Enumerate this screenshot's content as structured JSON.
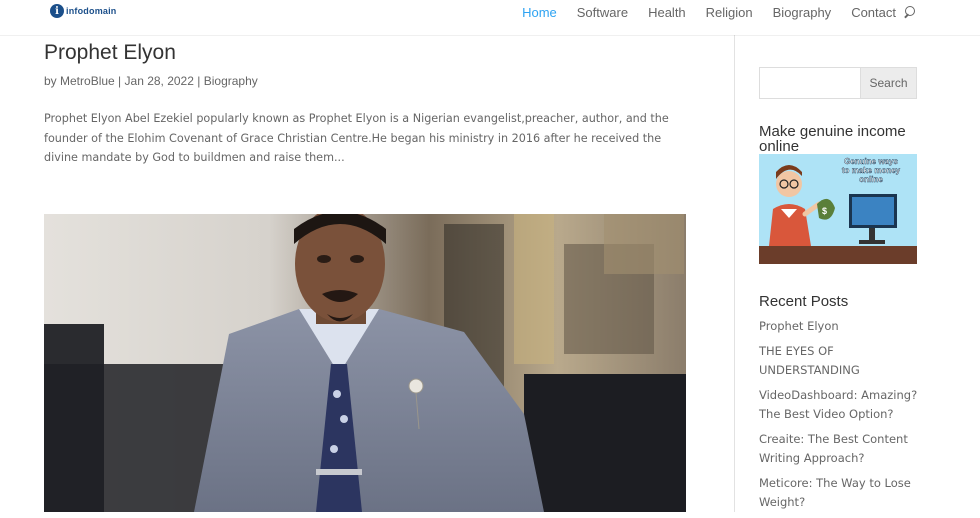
{
  "site": {
    "logo_letter": "i",
    "logo_text": "infodomain"
  },
  "nav": {
    "items": [
      {
        "label": "Home",
        "active": true
      },
      {
        "label": "Software",
        "active": false
      },
      {
        "label": "Health",
        "active": false
      },
      {
        "label": "Religion",
        "active": false
      },
      {
        "label": "Biography",
        "active": false
      },
      {
        "label": "Contact",
        "active": false
      }
    ],
    "search_icon": "search-icon"
  },
  "post": {
    "title": "Prophet Elyon",
    "author": "MetroBlue",
    "date": "Jan 28, 2022",
    "category": "Biography",
    "excerpt": "Prophet Elyon Abel Ezekiel popularly known as Prophet Elyon is a Nigerian evangelist,preacher, author, and the founder of the Elohim Covenant of Grace Christian Centre.He began his ministry in 2016 after he received the divine mandate by God to buildmen and raise them..."
  },
  "sidebar": {
    "search": {
      "placeholder": "",
      "button_label": "Search"
    },
    "ad": {
      "title": "Make genuine income online",
      "image_text": "Genuine ways to make money online"
    },
    "recent": {
      "title": "Recent Posts",
      "items": [
        "Prophet Elyon",
        "THE EYES OF UNDERSTANDING",
        "VideoDashboard: Amazing? The Best Video Option?",
        "Creaite: The Best Content Writing Approach?",
        "Meticore: The Way to Lose Weight?"
      ]
    }
  },
  "colors": {
    "accent": "#2ea3f2",
    "heading": "#333333",
    "text": "#666666"
  }
}
